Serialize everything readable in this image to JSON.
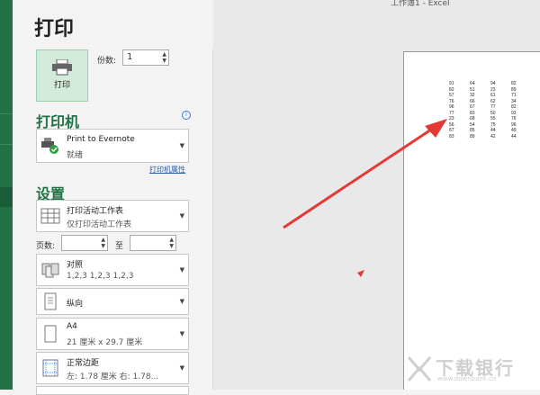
{
  "window": {
    "title": "工作簿1 - Excel"
  },
  "print": {
    "heading": "打印",
    "button_label": "打印",
    "copies_label": "份数:",
    "copies_value": "1"
  },
  "printer": {
    "heading": "打印机",
    "name": "Print to Evernote",
    "status": "就绪",
    "properties_link": "打印机属性"
  },
  "settings": {
    "heading": "设置",
    "scope": {
      "title": "打印活动工作表",
      "subtitle": "仅打印活动工作表"
    },
    "pages_label": "页数:",
    "pages_to": "至",
    "collate": {
      "title": "对照",
      "subtitle": "1,2,3    1,2,3    1,2,3"
    },
    "orientation": {
      "title": "纵向"
    },
    "paper": {
      "title": "A4",
      "subtitle": "21 厘米 x 29.7 厘米"
    },
    "margins": {
      "title": "正常边距",
      "subtitle": "左: 1.78 厘米    右: 1.78..."
    }
  },
  "preview": {
    "cells": [
      [
        "91",
        "64",
        "94",
        "82"
      ],
      [
        "82",
        "51",
        "23",
        "89"
      ],
      [
        "57",
        "32",
        "61",
        "71"
      ],
      [
        "76",
        "66",
        "62",
        "34"
      ],
      [
        "96",
        "67",
        "77",
        "82"
      ],
      [
        "77",
        "83",
        "50",
        "93"
      ],
      [
        "23",
        "68",
        "55",
        "76"
      ],
      [
        "56",
        "54",
        "75",
        "96"
      ],
      [
        "67",
        "85",
        "44",
        "49"
      ],
      [
        "83",
        "89",
        "42",
        "44"
      ]
    ]
  },
  "watermark": {
    "text": "下载银行",
    "url": "www.downbank.cn"
  },
  "colors": {
    "accent": "#217346",
    "arrow": "#e53935"
  }
}
